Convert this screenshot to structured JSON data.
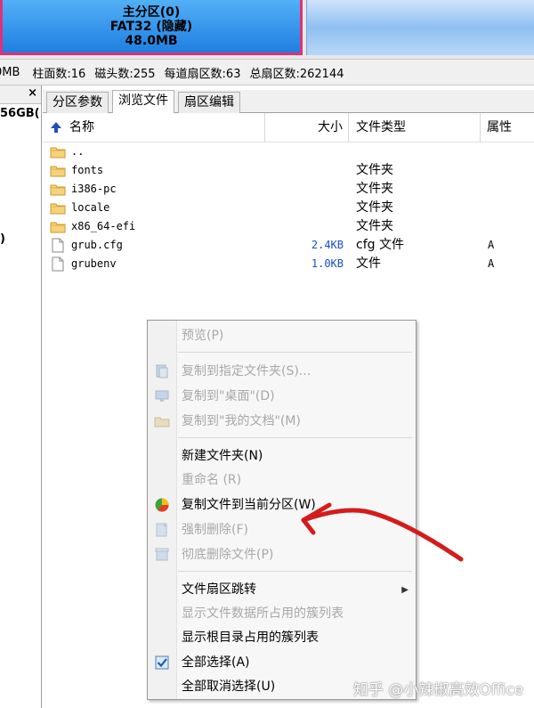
{
  "partition": {
    "name": "主分区(0)",
    "fs": "FAT32 (隐藏)",
    "size": "48.0MB"
  },
  "info_bar": {
    "cut_prefix": "0MB",
    "cylinders": "柱面数:16",
    "heads": "磁头数:255",
    "sectors_per_track": "每道扇区数:63",
    "total_sectors": "总扇区数:262144"
  },
  "left_panel": {
    "close": "×",
    "item1": "56GB(",
    "item2": ")"
  },
  "tabs": [
    {
      "label": "分区参数"
    },
    {
      "label": "浏览文件"
    },
    {
      "label": "扇区编辑"
    }
  ],
  "columns": {
    "name": "名称",
    "size": "大小",
    "type": "文件类型",
    "attr": "属性"
  },
  "files": [
    {
      "name": "..",
      "size": "",
      "type": "",
      "attr": "",
      "icon": "folder-icon"
    },
    {
      "name": "fonts",
      "size": "",
      "type": "文件夹",
      "attr": "",
      "icon": "folder-icon"
    },
    {
      "name": "i386-pc",
      "size": "",
      "type": "文件夹",
      "attr": "",
      "icon": "folder-icon"
    },
    {
      "name": "locale",
      "size": "",
      "type": "文件夹",
      "attr": "",
      "icon": "folder-icon"
    },
    {
      "name": "x86_64-efi",
      "size": "",
      "type": "文件夹",
      "attr": "",
      "icon": "folder-icon"
    },
    {
      "name": "grub.cfg",
      "size": "2.4KB",
      "type": "cfg 文件",
      "attr": "A",
      "icon": "file-icon"
    },
    {
      "name": "grubenv",
      "size": "1.0KB",
      "type": "文件",
      "attr": "A",
      "icon": "file-icon"
    }
  ],
  "context_menu": {
    "preview": "预览(P)",
    "copy_to_folder": "复制到指定文件夹(S)...",
    "copy_to_desktop": "复制到\"桌面\"(D)",
    "copy_to_documents": "复制到\"我的文档\"(M)",
    "new_folder": "新建文件夹(N)",
    "rename": "重命名 (R)",
    "copy_to_current_partition": "复制文件到当前分区(W)",
    "force_delete": "强制删除(F)",
    "wipe_delete": "彻底删除文件(P)",
    "file_sector_jump": "文件扇区跳转",
    "show_clusters": "显示文件数据所占用的簇列表",
    "show_root_clusters": "显示根目录占用的簇列表",
    "select_all": "全部选择(A)",
    "deselect_all": "全部取消选择(U)"
  },
  "annotation": {
    "arrow_color": "#d41c1c"
  },
  "watermark": "知乎 @小辣椒高效Office",
  "colors": {
    "partition_fill": "#1f7fe0",
    "partition_border": "#e0307a",
    "size_text": "#1a4fc8",
    "disabled_text": "#a8a8a8"
  }
}
